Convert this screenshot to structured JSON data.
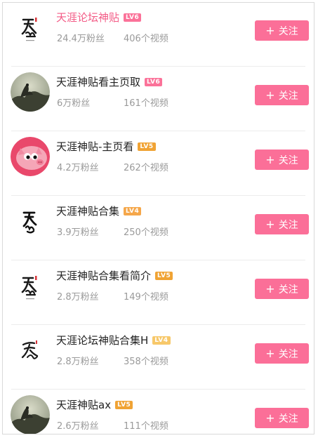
{
  "follow_label": "关注",
  "users": [
    {
      "name": "天涯论坛神贴",
      "level": "LV6",
      "level_color": "#fb7299",
      "name_color": "#f35b86",
      "fans": "24.4万粉丝",
      "videos": "406个视频",
      "avatar": "calligraphy-seal"
    },
    {
      "name": "天涯神贴看主页取",
      "level": "LV6",
      "level_color": "#fb7299",
      "name_color": "#222222",
      "fans": "6万粉丝",
      "videos": "161个视频",
      "avatar": "ink-landscape"
    },
    {
      "name": "天涯神贴-主页看",
      "level": "LV5",
      "level_color": "#f0a334",
      "name_color": "#222222",
      "fans": "4.2万粉丝",
      "videos": "262个视频",
      "avatar": "pink-cartoon-pig"
    },
    {
      "name": "天涯神贴合集",
      "level": "LV4",
      "level_color": "#f5a74a",
      "name_color": "#222222",
      "fans": "3.9万粉丝",
      "videos": "250个视频",
      "avatar": "calligraphy-plain"
    },
    {
      "name": "天涯神贴合集看简介",
      "level": "LV5",
      "level_color": "#f0a334",
      "name_color": "#222222",
      "fans": "2.8万粉丝",
      "videos": "149个视频",
      "avatar": "calligraphy-seal"
    },
    {
      "name": "天涯论坛神贴合集H",
      "level": "LV4",
      "level_color": "#f7c86a",
      "name_color": "#222222",
      "fans": "2.8万粉丝",
      "videos": "358个视频",
      "avatar": "calligraphy-cursive"
    },
    {
      "name": "天涯神贴ax",
      "level": "LV5",
      "level_color": "#f0a334",
      "name_color": "#222222",
      "fans": "2.6万粉丝",
      "videos": "111个视频",
      "avatar": "ink-landscape"
    }
  ],
  "colors": {
    "follow_button": "#fb6f98",
    "divider": "#ececec",
    "stat_text": "#9a9a9a"
  }
}
